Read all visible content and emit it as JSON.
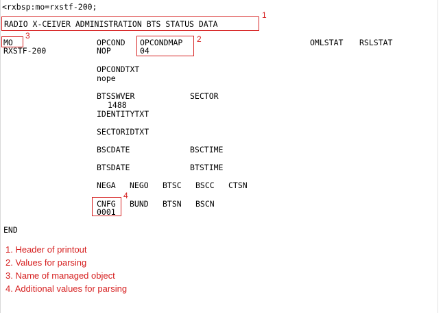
{
  "command": "<rxbsp:mo=rxstf-200;",
  "header": "RADIO X-CEIVER ADMINISTRATION BTS STATUS DATA",
  "columns": {
    "mo": "MO",
    "opcond": "OPCOND",
    "opcondmap": "OPCONDMAP",
    "omlstat": "OMLSTAT",
    "rslstat": "RSLSTAT"
  },
  "values": {
    "mo": "RXSTF-200",
    "opcond": "NOP",
    "opcondmap": "04"
  },
  "opcondtxt": {
    "label": "OPCONDTXT",
    "value": "nope"
  },
  "btsswver": {
    "label": "BTSSWVER",
    "value": "1488"
  },
  "sector_label": "SECTOR",
  "identitytxt_label": "IDENTITYTXT",
  "sectoridtxt_label": "SECTORIDTXT",
  "bscdate_label": "BSCDATE",
  "bsctime_label": "BSCTIME",
  "btsdate_label": "BTSDATE",
  "btstime_label": "BTSTIME",
  "nego_row": [
    "NEGA",
    "NEGO",
    "BTSC",
    "BSCC",
    "CTSN"
  ],
  "cnfg": {
    "label": "CNFG",
    "value": "0001"
  },
  "cnfg_row_rest": [
    "BUND",
    "BTSN",
    "BSCN"
  ],
  "end": "END",
  "annotations": {
    "color": "#d62020",
    "markers": [
      "1",
      "2",
      "3",
      "4"
    ],
    "legend": [
      "1. Header of printout",
      "2. Values for parsing",
      "3. Name of managed object",
      "4. Additional values for parsing"
    ]
  }
}
